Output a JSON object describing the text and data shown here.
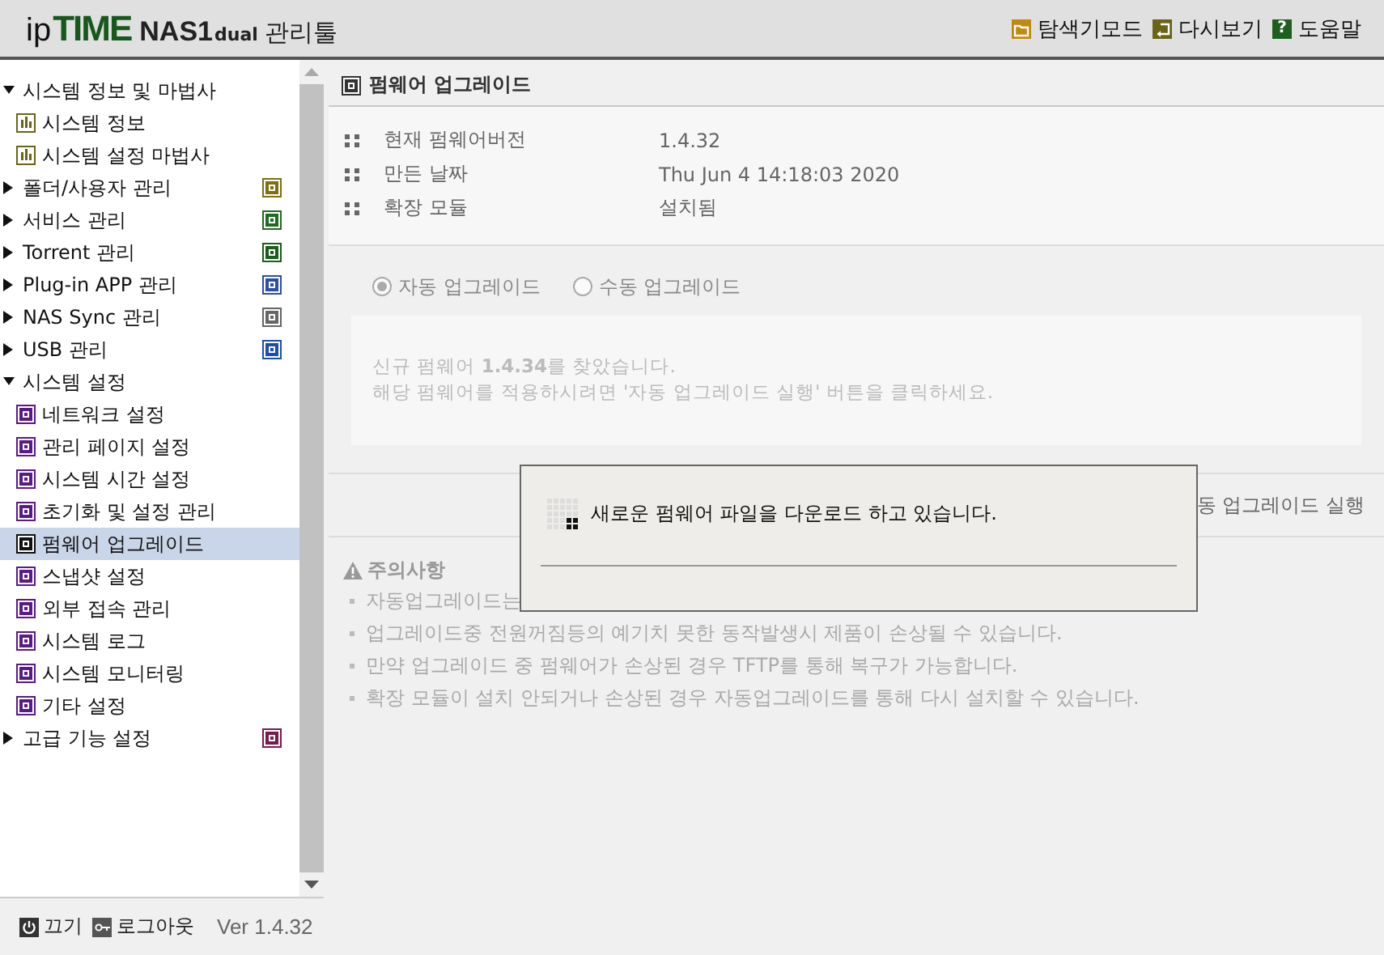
{
  "header": {
    "logo": {
      "brand_ip": "ip",
      "brand_time": "TIME",
      "model": "NAS1",
      "edition": "dual",
      "suffix": "관리툴"
    },
    "links": [
      {
        "label": "탐색기모드",
        "color": "#c08a10"
      },
      {
        "label": "다시보기",
        "color": "#6b6416"
      },
      {
        "label": "도움말",
        "color": "#1e5e1e",
        "glyph": "?"
      }
    ]
  },
  "sidebar": {
    "items": [
      {
        "label": "시스템 정보 및 마법사",
        "expanded": true,
        "children": [
          {
            "label": "시스템 정보",
            "selected": false
          },
          {
            "label": "시스템 설정 마법사",
            "selected": false
          }
        ]
      },
      {
        "label": "폴더/사용자 관리",
        "expanded": false,
        "color": "#7d7010"
      },
      {
        "label": "서비스 관리",
        "expanded": false,
        "color": "#1f6b1f"
      },
      {
        "label": "Torrent 관리",
        "expanded": false,
        "color": "#1a5e1a"
      },
      {
        "label": "Plug-in APP 관리",
        "expanded": false,
        "color": "#2a4fa8"
      },
      {
        "label": "NAS Sync 관리",
        "expanded": false,
        "color": "#666666"
      },
      {
        "label": "USB 관리",
        "expanded": false,
        "color": "#1a4fb0"
      },
      {
        "label": "시스템 설정",
        "expanded": true,
        "children": [
          {
            "label": "네트워크 설정",
            "selected": false
          },
          {
            "label": "관리 페이지 설정",
            "selected": false
          },
          {
            "label": "시스템 시간 설정",
            "selected": false
          },
          {
            "label": "초기화 및 설정 관리",
            "selected": false
          },
          {
            "label": "펌웨어 업그레이드",
            "selected": true
          },
          {
            "label": "스냅샷 설정",
            "selected": false
          },
          {
            "label": "외부 접속 관리",
            "selected": false
          },
          {
            "label": "시스템 로그",
            "selected": false
          },
          {
            "label": "시스템 모니터링",
            "selected": false
          },
          {
            "label": "기타 설정",
            "selected": false
          }
        ]
      },
      {
        "label": "고급 기능 설정",
        "expanded": false,
        "color": "#7a1a4a"
      }
    ],
    "footer": {
      "power": "끄기",
      "logout": "로그아웃",
      "version": "Ver 1.4.32"
    }
  },
  "content": {
    "title": "펌웨어 업그레이드",
    "info": [
      {
        "label": "현재 펌웨어버전",
        "value": "1.4.32"
      },
      {
        "label": "만든 날짜",
        "value": "Thu Jun 4 14:18:03 2020"
      },
      {
        "label": "확장 모듈",
        "value": "설치됨"
      }
    ],
    "modes": [
      {
        "label": "자동 업그레이드",
        "selected": true
      },
      {
        "label": "수동 업그레이드",
        "selected": false
      }
    ],
    "message": [
      "신규 펌웨어 **1.4.34**를 찾았습니다.",
      "해당 펌웨어를 적용하시려면 '자동 업그레이드 실행' 버튼을 클릭하세요."
    ],
    "run_button": "동 업그레이드 실행",
    "notice": {
      "title": "주의사항",
      "items": [
        "자동업그레이드는",
        "업그레이드중 전원꺼짐등의 예기치 못한 동작발생시 제품이 손상될 수 있습니다.",
        "만약 업그레이드 중 펌웨어가 손상된 경우 TFTP를 통해 복구가 가능합니다.",
        "확장 모듈이 설치 안되거나 손상된 경우 자동업그레이드를 통해 다시 설치할 수 있습니다."
      ]
    }
  },
  "dialog": {
    "message": "새로운 펌웨어 파일을 다운로드 하고 있습니다."
  }
}
